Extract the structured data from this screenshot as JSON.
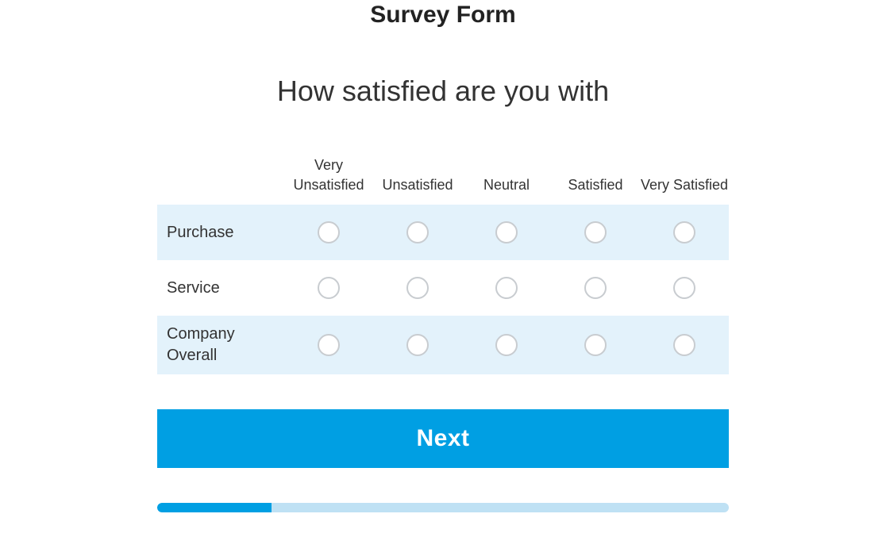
{
  "title": "Survey Form",
  "question": "How satisfied are you with",
  "columns": [
    "Very Unsatisfied",
    "Unsatisfied",
    "Neutral",
    "Satisfied",
    "Very Satisfied"
  ],
  "rows": [
    "Purchase",
    "Service",
    "Company Overall"
  ],
  "next_label": "Next",
  "progress_percent": 20,
  "accent_color": "#009fe3",
  "row_alt_color": "#e3f2fb"
}
